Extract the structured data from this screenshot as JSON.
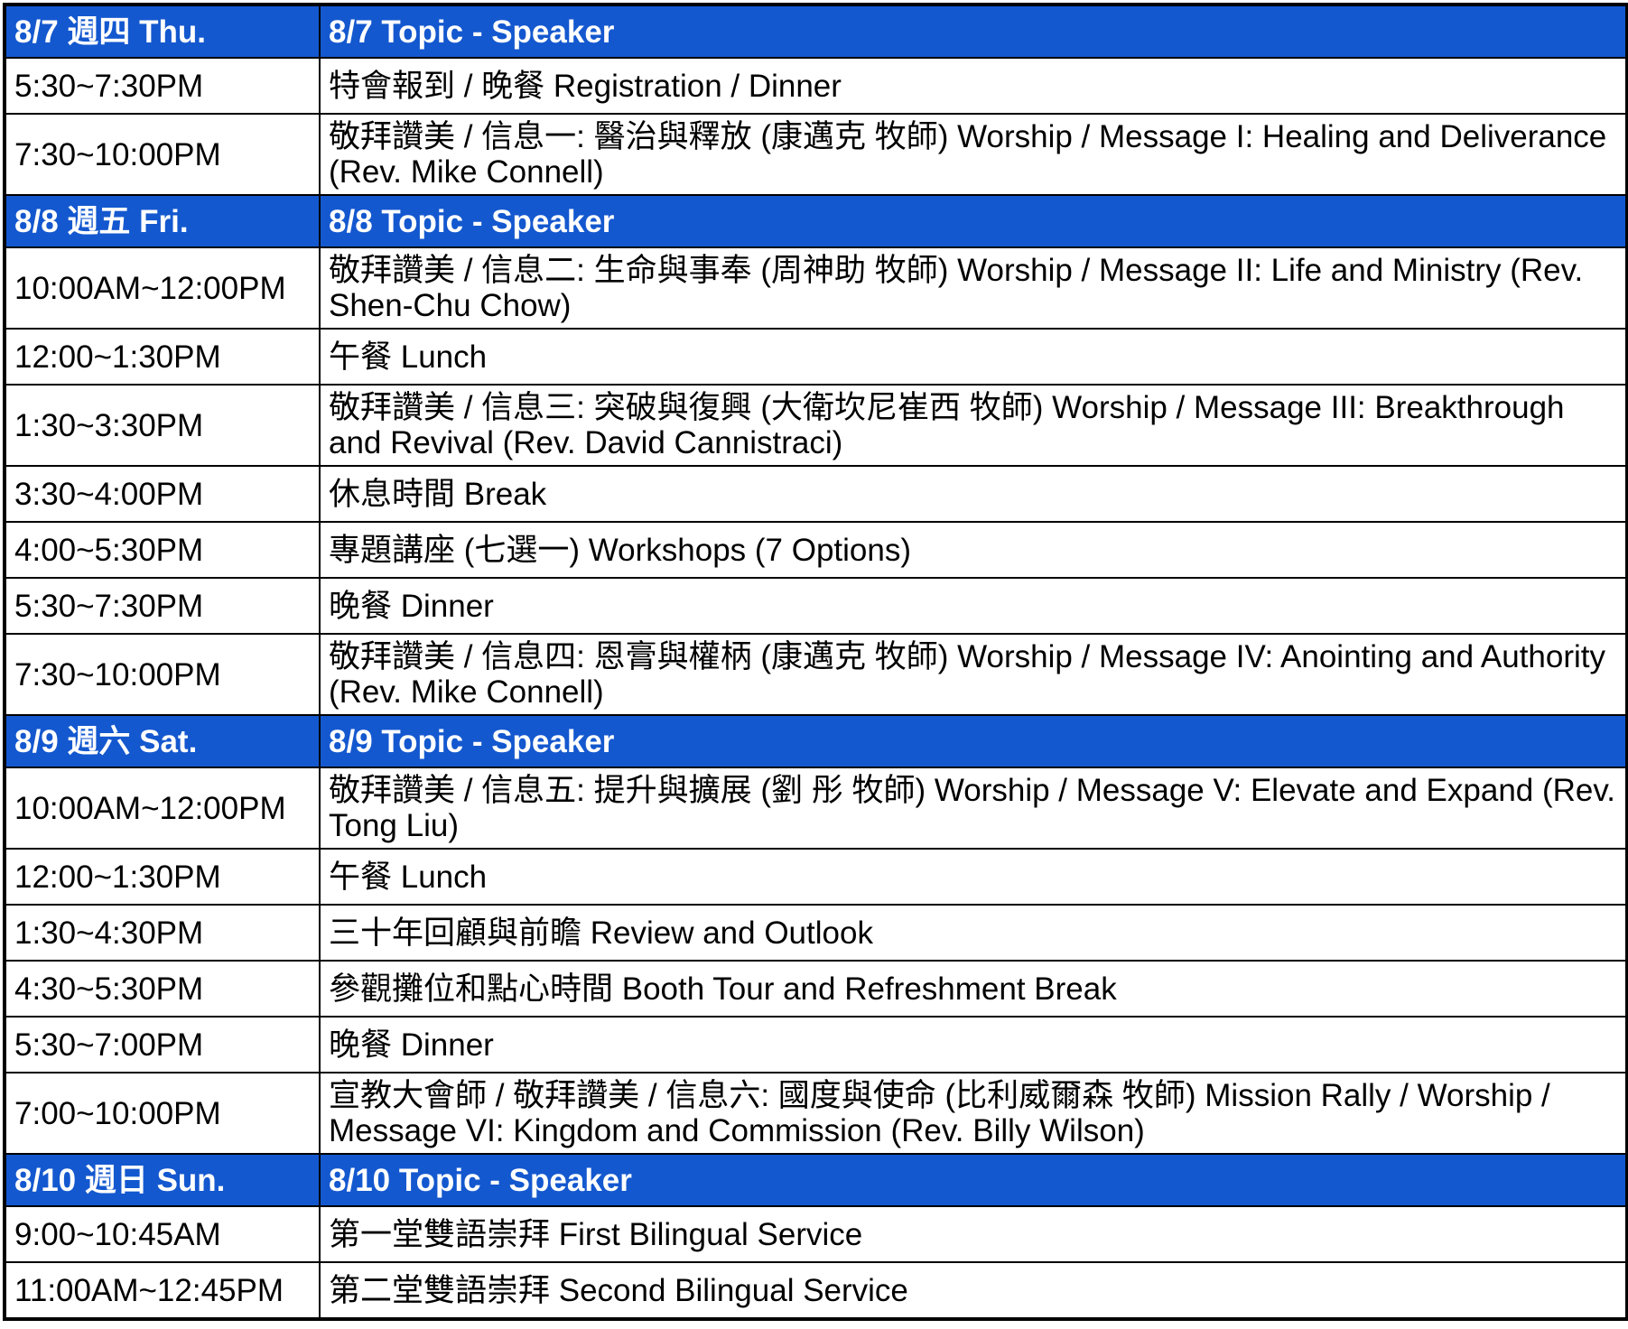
{
  "days": [
    {
      "day_label": "8/7 週四 Thu.",
      "topic_label": "8/7 Topic - Speaker",
      "rows": [
        {
          "time": "5:30~7:30PM",
          "desc": "特會報到 / 晚餐 Registration / Dinner"
        },
        {
          "time": "7:30~10:00PM",
          "desc": "敬拜讚美 / 信息一: 醫治與釋放 (康邁克 牧師) Worship / Message I: Healing and Deliverance (Rev. Mike Connell)"
        }
      ]
    },
    {
      "day_label": "8/8 週五 Fri.",
      "topic_label": "8/8 Topic - Speaker",
      "rows": [
        {
          "time": "10:00AM~12:00PM",
          "desc": "敬拜讚美 / 信息二: 生命與事奉 (周神助 牧師) Worship / Message II: Life and Ministry (Rev. Shen-Chu Chow)"
        },
        {
          "time": "12:00~1:30PM",
          "desc": "午餐 Lunch"
        },
        {
          "time": "1:30~3:30PM",
          "desc": "敬拜讚美 / 信息三: 突破與復興 (大衛坎尼崔西 牧師) Worship / Message III: Breakthrough and Revival (Rev. David Cannistraci)"
        },
        {
          "time": "3:30~4:00PM",
          "desc": "休息時間 Break"
        },
        {
          "time": "4:00~5:30PM",
          "desc": "專題講座 (七選一) Workshops (7 Options)"
        },
        {
          "time": "5:30~7:30PM",
          "desc": "晚餐 Dinner"
        },
        {
          "time": "7:30~10:00PM",
          "desc": "敬拜讚美 / 信息四: 恩膏與權柄 (康邁克 牧師) Worship / Message IV: Anointing and Authority (Rev. Mike Connell)"
        }
      ]
    },
    {
      "day_label": "8/9 週六 Sat.",
      "topic_label": "8/9 Topic - Speaker",
      "rows": [
        {
          "time": "10:00AM~12:00PM",
          "desc": "敬拜讚美 / 信息五: 提升與擴展 (劉 彤 牧師) Worship / Message V: Elevate and Expand (Rev. Tong Liu)"
        },
        {
          "time": "12:00~1:30PM",
          "desc": "午餐 Lunch"
        },
        {
          "time": "1:30~4:30PM",
          "desc": "三十年回顧與前瞻 Review and Outlook"
        },
        {
          "time": "4:30~5:30PM",
          "desc": "參觀攤位和點心時間 Booth Tour and Refreshment Break"
        },
        {
          "time": "5:30~7:00PM",
          "desc": "晚餐 Dinner"
        },
        {
          "time": "7:00~10:00PM",
          "desc": "宣教大會師 / 敬拜讚美 / 信息六: 國度與使命 (比利威爾森 牧師) Mission Rally / Worship / Message VI: Kingdom and Commission (Rev. Billy Wilson)"
        }
      ]
    },
    {
      "day_label": "8/10 週日 Sun.",
      "topic_label": "8/10 Topic - Speaker",
      "rows": [
        {
          "time": "9:00~10:45AM",
          "desc": "第一堂雙語崇拜 First Bilingual Service"
        },
        {
          "time": "11:00AM~12:45PM",
          "desc": "第二堂雙語崇拜 Second Bilingual Service"
        }
      ]
    }
  ]
}
